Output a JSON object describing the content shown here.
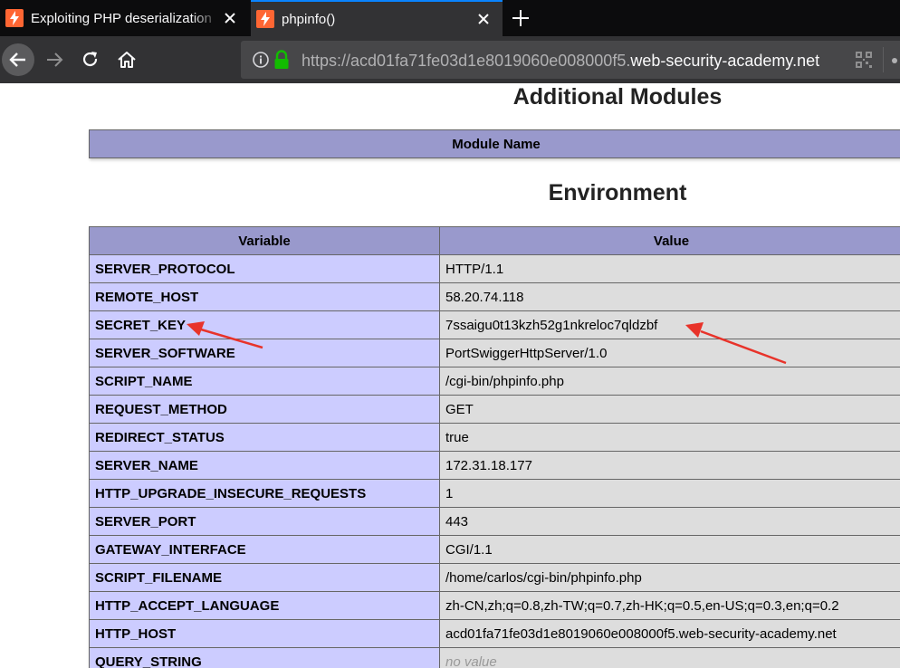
{
  "browser": {
    "tabs": [
      {
        "title": "Exploiting PHP deserialization",
        "active": false
      },
      {
        "title": "phpinfo()",
        "active": true
      }
    ],
    "url": {
      "prefix": "https://acd01fa71fe03d1e8019060e008000f5.",
      "host": "web-security-academy.net"
    }
  },
  "modules": {
    "heading": "Additional Modules",
    "column": "Module Name"
  },
  "environment": {
    "heading": "Environment",
    "columns": [
      "Variable",
      "Value"
    ],
    "rows": [
      {
        "variable": "SERVER_PROTOCOL",
        "value": "HTTP/1.1"
      },
      {
        "variable": "REMOTE_HOST",
        "value": "58.20.74.118"
      },
      {
        "variable": "SECRET_KEY",
        "value": "7ssaigu0t13kzh52g1nkreloc7qldzbf"
      },
      {
        "variable": "SERVER_SOFTWARE",
        "value": "PortSwiggerHttpServer/1.0"
      },
      {
        "variable": "SCRIPT_NAME",
        "value": "/cgi-bin/phpinfo.php"
      },
      {
        "variable": "REQUEST_METHOD",
        "value": "GET"
      },
      {
        "variable": "REDIRECT_STATUS",
        "value": "true"
      },
      {
        "variable": "SERVER_NAME",
        "value": "172.31.18.177"
      },
      {
        "variable": "HTTP_UPGRADE_INSECURE_REQUESTS",
        "value": "1"
      },
      {
        "variable": "SERVER_PORT",
        "value": "443"
      },
      {
        "variable": "GATEWAY_INTERFACE",
        "value": "CGI/1.1"
      },
      {
        "variable": "SCRIPT_FILENAME",
        "value": "/home/carlos/cgi-bin/phpinfo.php"
      },
      {
        "variable": "HTTP_ACCEPT_LANGUAGE",
        "value": "zh-CN,zh;q=0.8,zh-TW;q=0.7,zh-HK;q=0.5,en-US;q=0.3,en;q=0.2"
      },
      {
        "variable": "HTTP_HOST",
        "value": "acd01fa71fe03d1e8019060e008000f5.web-security-academy.net"
      },
      {
        "variable": "QUERY_STRING",
        "value": "no value"
      }
    ]
  },
  "colors": {
    "annotation": "#e8332a",
    "header_bg": "#9999cc",
    "key_bg": "#ccccff",
    "value_bg": "#dddddd"
  }
}
